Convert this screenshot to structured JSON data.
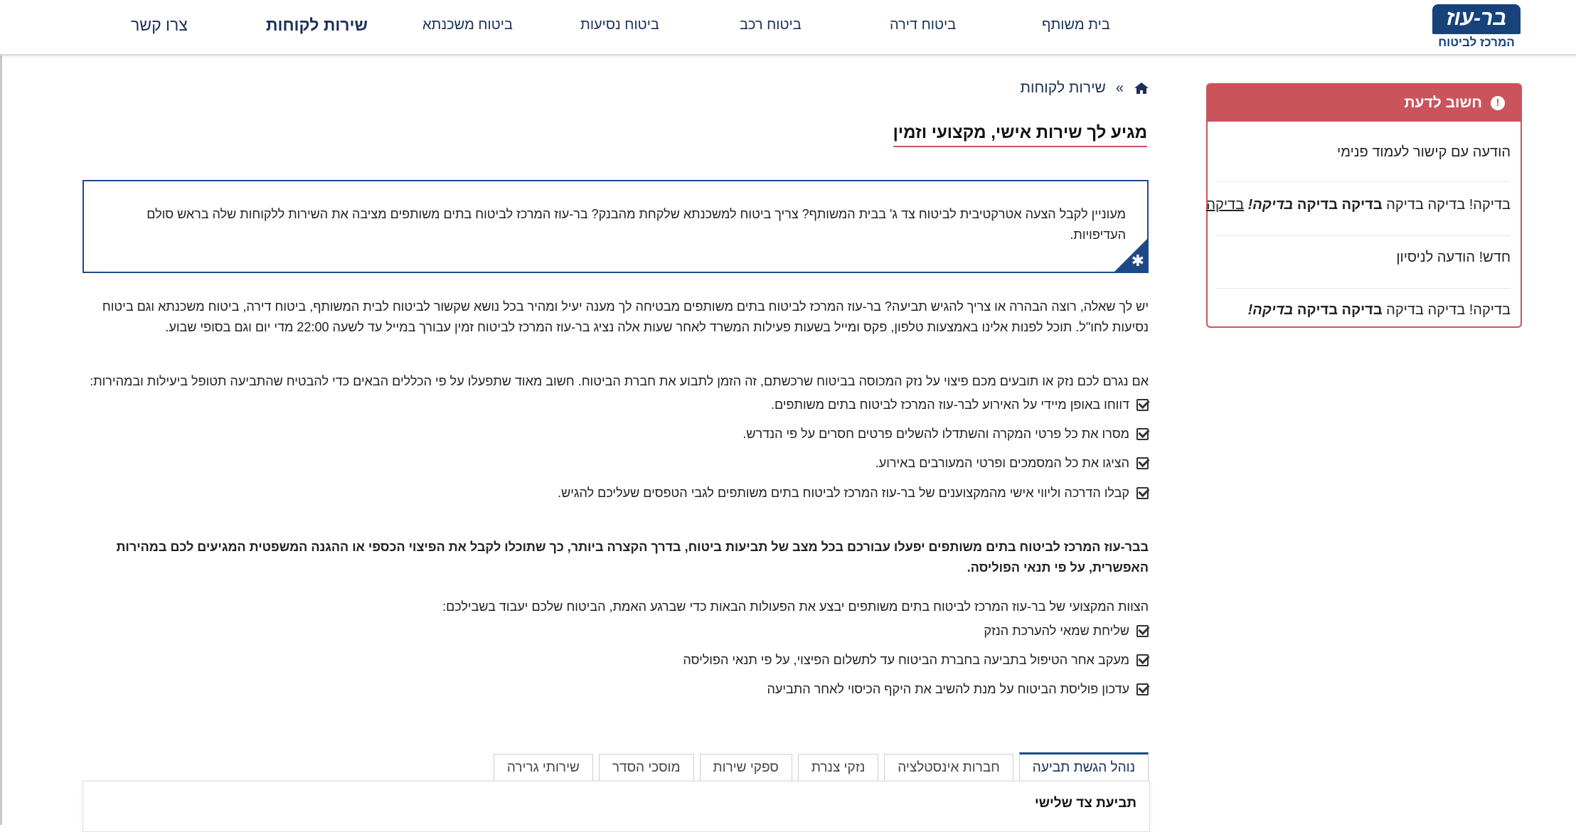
{
  "logo": {
    "text": "בר-עוז",
    "sub": "המרכז לביטוח"
  },
  "nav": {
    "items": [
      "בית משותף",
      "ביטוח דירה",
      "ביטוח רכב",
      "ביטוח נסיעות",
      "ביטוח משכנתא"
    ],
    "customer_service": "שירות לקוחות",
    "contact": "צרו קשר"
  },
  "sidebar": {
    "header": "חשוב לדעת",
    "icon": "exclamation-icon",
    "item1": "הודעה עם קישור לעמוד פנימי",
    "item2_a": "בדיקה! בדיקה בדיקה ",
    "item2_b": "בדיקה בדיקה",
    "item2_c": " בדיקה!",
    "item2_link": "בדיקה",
    "item3": "חדש! הודעה לניסיון",
    "item4_a": "בדיקה! בדיקה בדיקה ",
    "item4_b": "בדיקה בדיקה",
    "item4_c": " בדיקה!"
  },
  "breadcrumb": {
    "home_icon": "home-icon",
    "sep": "»",
    "current": "שירות לקוחות"
  },
  "page_title": "מגיע לך שירות אישי, מקצועי וזמין",
  "intro": "מעוניין לקבל הצעה אטרקטיבית לביטוח צד ג' בבית המשותף? צריך ביטוח למשכנתא שלקחת מהבנק? בר-עוז המרכז לביטוח בתים משותפים מציבה את השירות ללקוחות שלה בראש סולם העדיפויות.",
  "para1": "יש לך שאלה, רוצה הבהרה או צריך להגיש תביעה? בר-עוז המרכז לביטוח בתים משותפים מבטיחה לך מענה יעיל ומהיר בכל נושא שקשור לביטוח לבית המשותף, ביטוח דירה, ביטוח משכנתא וגם ביטוח נסיעות לחו\"ל. תוכל לפנות אלינו באמצעות טלפון, פקס ומייל בשעות פעילות המשרד לאחר שעות אלה נציג בר-עוז המרכז לביטוח  זמין עבורך במייל עד לשעה 22:00 מדי יום וגם בסופי שבוע.",
  "para2": "אם נגרם לכם נזק או תובעים מכם פיצוי על נזק המכוסה בביטוח שרכשתם, זה הזמן לתבוע את חברת הביטוח. חשוב מאוד שתפעלו על פי הכללים הבאים כדי להבטיח שהתביעה תטופל ביעילות ובמהירות:",
  "list1": [
    "דווחו באופן מיידי על האירוע לבר-עוז המרכז לביטוח בתים משותפים.",
    "מסרו את כל פרטי המקרה והשתדלו להשלים פרטים חסרים על פי הנדרש.",
    "הציגו את כל המסמכים ופרטי המעורבים באירוע.",
    "קבלו הדרכה וליווי אישי מהמקצוענים של בר-עוז המרכז לביטוח בתים משותפים לגבי הטפסים שעליכם להגיש."
  ],
  "para3": "בבר-עוז המרכז לביטוח בתים משותפים יפעלו עבורכם בכל מצב של תביעות ביטוח, בדרך הקצרה ביותר, כך שתוכלו  לקבל את הפיצוי הכספי או ההגנה המשפטית המגיעים לכם במהירות האפשרית, על פי תנאי הפוליסה.",
  "para4": "הצוות המקצועי של בר-עוז המרכז לביטוח בתים משותפים יבצע את הפעולות הבאות כדי שברגע האמת, הביטוח שלכם יעבוד בשבילכם:",
  "list2": [
    "שליחת שמאי להערכת הנזק",
    "מעקב אחר הטיפול בתביעה בחברת הביטוח עד לתשלום הפיצוי, על פי תנאי הפוליסה",
    "עדכון פוליסת הביטוח על מנת להשיב את היקף הכיסוי לאחר התביעה"
  ],
  "tabs": [
    "נוהל הגשת תביעה",
    "חברות אינסטלציה",
    "נזקי צנרת",
    "ספקי שירות",
    "מוסכי הסדר",
    "שירותי גרירה"
  ],
  "panel_heading": "תביעת צד שלישי"
}
